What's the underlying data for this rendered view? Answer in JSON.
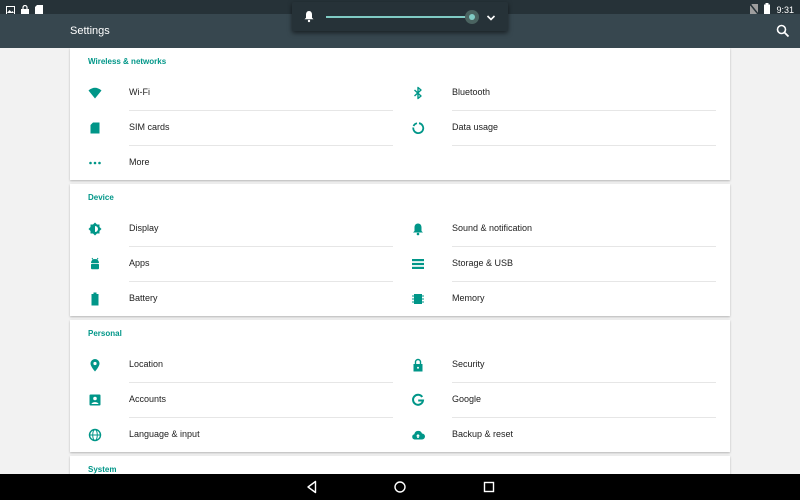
{
  "status_bar": {
    "time": "9:31",
    "left_icons": [
      "image-icon",
      "lock-icon",
      "sd-card-icon"
    ],
    "right_icons": [
      "no-sim-icon",
      "battery-icon"
    ]
  },
  "app_bar": {
    "title": "Settings",
    "search_icon": "search-icon"
  },
  "volume_panel": {
    "icon": "bell-icon",
    "level": 1.0,
    "expand_icon": "chevron-down-icon"
  },
  "sections": [
    {
      "header": "Wireless & networks",
      "items": [
        {
          "label": "Wi-Fi",
          "icon": "wifi-icon"
        },
        {
          "label": "Bluetooth",
          "icon": "bluetooth-icon"
        },
        {
          "label": "SIM cards",
          "icon": "sim-card-icon"
        },
        {
          "label": "Data usage",
          "icon": "data-usage-icon"
        },
        {
          "label": "More",
          "icon": "more-icon"
        }
      ]
    },
    {
      "header": "Device",
      "items": [
        {
          "label": "Display",
          "icon": "display-icon"
        },
        {
          "label": "Sound & notification",
          "icon": "bell-icon"
        },
        {
          "label": "Apps",
          "icon": "android-icon"
        },
        {
          "label": "Storage & USB",
          "icon": "storage-icon"
        },
        {
          "label": "Battery",
          "icon": "battery-icon"
        },
        {
          "label": "Memory",
          "icon": "memory-icon"
        }
      ]
    },
    {
      "header": "Personal",
      "items": [
        {
          "label": "Location",
          "icon": "location-icon"
        },
        {
          "label": "Security",
          "icon": "lock-icon"
        },
        {
          "label": "Accounts",
          "icon": "account-icon"
        },
        {
          "label": "Google",
          "icon": "google-icon"
        },
        {
          "label": "Language & input",
          "icon": "globe-icon"
        },
        {
          "label": "Backup & reset",
          "icon": "cloud-upload-icon"
        }
      ]
    },
    {
      "header": "System",
      "items": []
    }
  ],
  "nav_bar": {
    "buttons": [
      "back-icon",
      "home-icon",
      "recents-icon"
    ]
  },
  "colors": {
    "accent": "#009688",
    "app_bar": "#37474f",
    "status_bar": "#263238",
    "background": "#f2f2f2"
  }
}
